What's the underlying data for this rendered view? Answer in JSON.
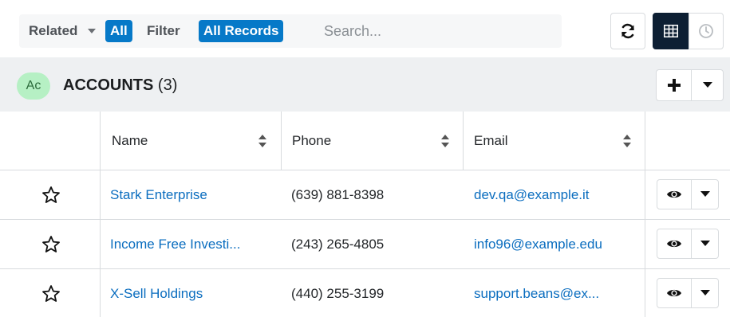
{
  "toolbar": {
    "related_label": "Related",
    "related_value": "All",
    "filter_label": "Filter",
    "filter_value": "All Records",
    "search_placeholder": "Search...",
    "icons": [
      "refresh-icon",
      "list-view-icon",
      "activity-stream-icon"
    ]
  },
  "subpanel": {
    "avatar": "Ac",
    "title": "ACCOUNTS",
    "count": "(3)",
    "icons": [
      "plus-icon",
      "chevron-down-icon"
    ]
  },
  "table": {
    "columns": [
      "Name",
      "Phone",
      "Email"
    ],
    "rows": [
      {
        "name": "Stark Enterprise",
        "phone": "(639) 881-8398",
        "email": "dev.qa@example.it"
      },
      {
        "name": "Income Free Investi...",
        "phone": "(243) 265-4805",
        "email": "info96@example.edu"
      },
      {
        "name": "X-Sell Holdings",
        "phone": "(440) 255-3199",
        "email": "support.beans@ex..."
      }
    ],
    "row_icons": [
      "star-icon",
      "eye-icon",
      "chevron-down-icon"
    ]
  },
  "colors": {
    "accent": "#0679c8",
    "link": "#0a6dbf",
    "panel_bg": "#eef0f2",
    "avatar_bg": "#b6f0c4",
    "active_toggle": "#0d1f33"
  }
}
